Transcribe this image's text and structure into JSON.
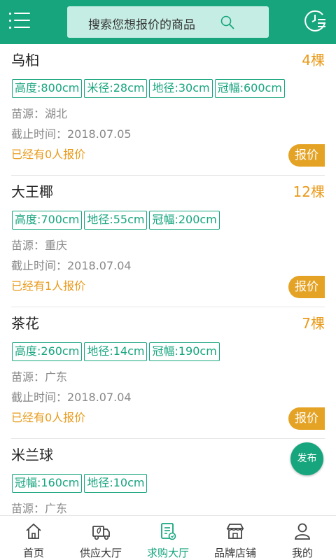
{
  "header": {
    "search_placeholder": "搜索您想报价的商品"
  },
  "listings": [
    {
      "name": "乌桕",
      "quantity": "4棵",
      "specs": [
        "高度:800cm",
        "米径:28cm",
        "地径:30cm",
        "冠幅:600cm"
      ],
      "origin": "苗源：湖北",
      "deadline": "截止时间：2018.07.05",
      "quotes": "已经有0人报价",
      "quote_button": "报价"
    },
    {
      "name": "大王椰",
      "quantity": "12棵",
      "specs": [
        "高度:700cm",
        "地径:55cm",
        "冠幅:200cm"
      ],
      "origin": "苗源：重庆",
      "deadline": "截止时间：2018.07.04",
      "quotes": "已经有1人报价",
      "quote_button": "报价"
    },
    {
      "name": "茶花",
      "quantity": "7棵",
      "specs": [
        "高度:260cm",
        "地径:14cm",
        "冠幅:190cm"
      ],
      "origin": "苗源：广东",
      "deadline": "截止时间：2018.07.04",
      "quotes": "已经有0人报价",
      "quote_button": "报价"
    },
    {
      "name": "米兰球",
      "quantity": "",
      "specs": [
        "冠幅:160cm",
        "地径:10cm"
      ],
      "origin": "苗源：广东",
      "deadline": "",
      "quotes": "",
      "quote_button": ""
    }
  ],
  "fab_label": "发布",
  "tabs": [
    {
      "label": "首页",
      "icon": "home-icon",
      "active": false
    },
    {
      "label": "供应大厅",
      "icon": "supply-truck-icon",
      "active": false
    },
    {
      "label": "求购大厅",
      "icon": "purchase-list-icon",
      "active": true
    },
    {
      "label": "品牌店铺",
      "icon": "store-icon",
      "active": false
    },
    {
      "label": "我的",
      "icon": "user-icon",
      "active": false
    }
  ],
  "colors": {
    "primary": "#17a57e",
    "accent": "#e89b1c",
    "quote_button": "#e4a325",
    "search_bg": "#c6ede3"
  }
}
